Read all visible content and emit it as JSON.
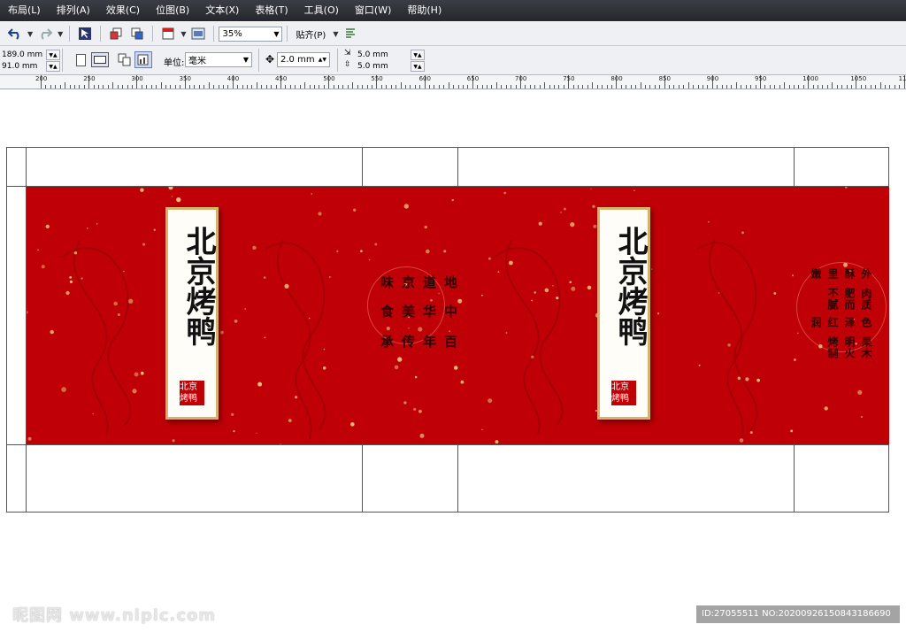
{
  "menu": [
    "布局(L)",
    "排列(A)",
    "效果(C)",
    "位图(B)",
    "文本(X)",
    "表格(T)",
    "工具(O)",
    "窗口(W)",
    "帮助(H)"
  ],
  "toolbar": {
    "zoom": "35%",
    "snap_label": "贴齐(P)"
  },
  "properties": {
    "width": "189.0 mm",
    "height": "91.0 mm",
    "unit_label": "单位:",
    "unit_value": "毫米",
    "nudge": "2.0 mm",
    "dup_x": "5.0 mm",
    "dup_y": "5.0 mm"
  },
  "ruler": {
    "labels": [
      "200",
      "250",
      "300",
      "350",
      "400",
      "450",
      "500",
      "550",
      "600",
      "650",
      "700",
      "750",
      "800",
      "850",
      "900",
      "950",
      "1000",
      "1050",
      "11"
    ]
  },
  "design": {
    "main_title": "北京烤鸭",
    "seal_text": "北京 烤鸭",
    "side1_lines": [
      "百年传承",
      "中华美食",
      "地道京味"
    ],
    "side2_lines": [
      "果木明火烤制",
      "色泽红润",
      "肉质肥而不腻",
      "外酥里嫩"
    ]
  },
  "watermark": {
    "site": "昵图网 www.nipic.com",
    "id": "ID:27055511 NO:20200926150843186690"
  },
  "colors": {
    "panel_red": "#c00007",
    "gold_border": "#d6b26c",
    "menubar": "#2e3036"
  }
}
